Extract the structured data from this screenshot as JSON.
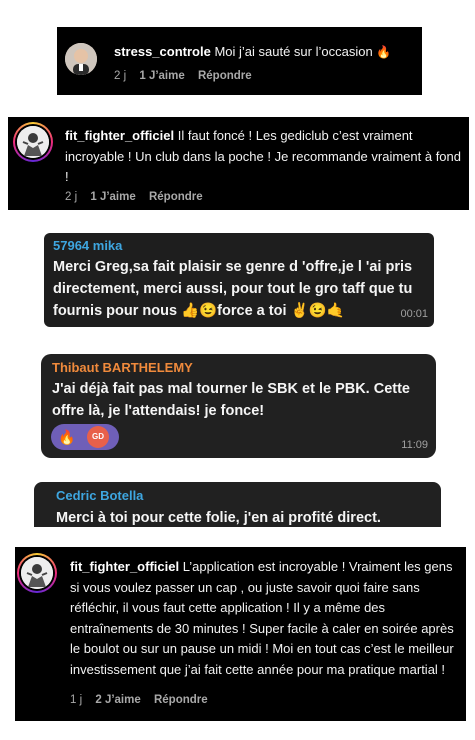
{
  "comment1": {
    "username": "stress_controle",
    "text": "Moi j’ai sauté sur l’occasion",
    "emoji": "🔥",
    "time": "2 j",
    "likes": "1 J’aime",
    "reply": "Répondre"
  },
  "comment2": {
    "username": "fit_fighter_officiel",
    "text": "Il faut foncé ! Les gediclub c’est vraiment incroyable ! Un club dans la poche ! Je recommande vraiment à fond !",
    "time": "2 j",
    "likes": "1 J’aime",
    "reply": "Répondre"
  },
  "msg1": {
    "sender": "57964 mika",
    "text": "Merci Greg,sa fait plaisir se genre d 'offre,je l 'ai pris directement, merci aussi, pour tout le gro taff que tu fournis pour nous 👍😉force a toi ✌️😉🤙",
    "time": "00:01",
    "sender_color": "#3ea6e0"
  },
  "msg2": {
    "sender": "Thibaut BARTHELEMY",
    "text": "J'ai déjà fait pas mal tourner le SBK et le PBK. Cette offre là, je l'attendais! je fonce!",
    "reaction_emoji": "🔥",
    "reaction_avatar": "GD",
    "time": "11:09",
    "sender_color": "#f08a3c"
  },
  "msg3": {
    "sender": "Cedric Botella",
    "text": "Merci à toi pour cette folie,  j'en ai profité direct.",
    "sender_color": "#3ea6e0"
  },
  "comment3": {
    "username": "fit_fighter_officiel",
    "text": "L’application est incroyable ! Vraiment les gens si vous voulez passer un cap , ou juste savoir quoi faire sans réfléchir, il vous faut cette application ! Il y a même des entraînements de 30 minutes ! Super facile à caler en soirée après le boulot ou sur un pause un midi ! Moi en tout cas c’est le meilleur investissement que j’ai fait cette année pour ma pratique martial !",
    "time": "1 j",
    "likes": "2 J’aime",
    "reply": "Répondre"
  }
}
